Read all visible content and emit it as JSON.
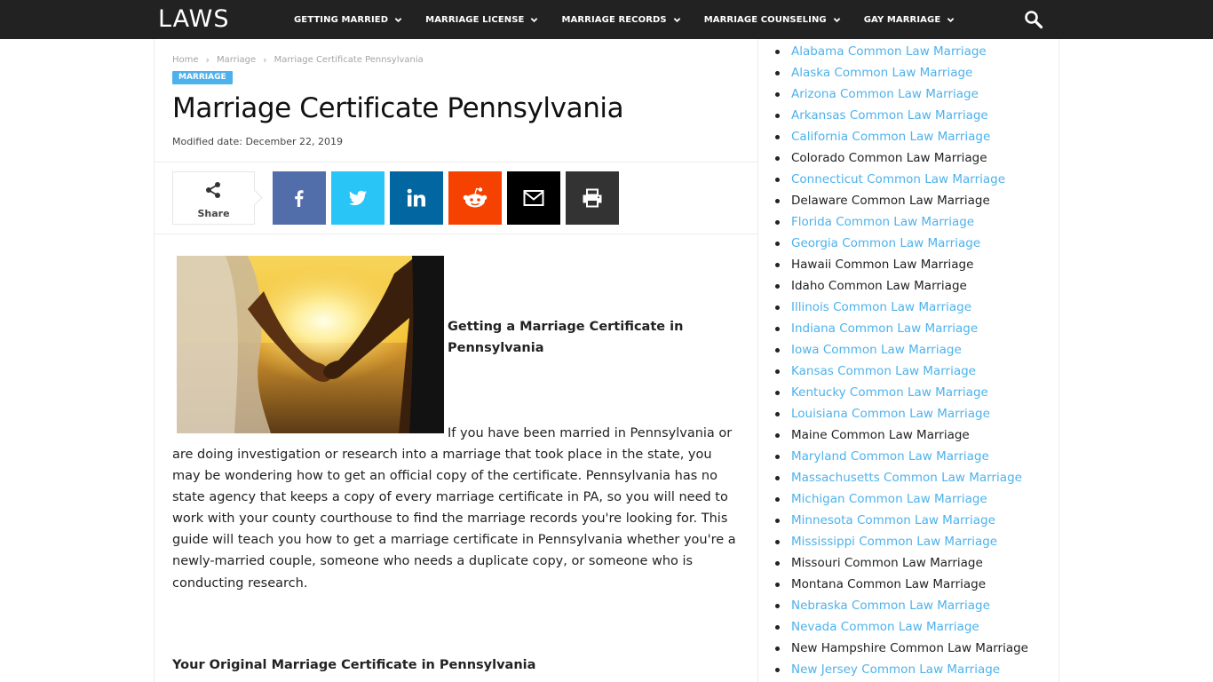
{
  "site": {
    "logo": "LAWS",
    "nav": [
      {
        "label": "GETTING MARRIED"
      },
      {
        "label": "MARRIAGE LICENSE"
      },
      {
        "label": "MARRIAGE RECORDS"
      },
      {
        "label": "MARRIAGE COUNSELING"
      },
      {
        "label": "GAY MARRIAGE"
      }
    ],
    "search_icon": "search-icon"
  },
  "breadcrumb": [
    "Home",
    "Marriage",
    "Marriage Certificate Pennsylvania"
  ],
  "article": {
    "category": "MARRIAGE",
    "title": "Marriage Certificate Pennsylvania",
    "modified": "Modified date: December 22, 2019",
    "share_label": "Share",
    "share_buttons": [
      {
        "name": "facebook",
        "color": "#516eab"
      },
      {
        "name": "twitter",
        "color": "#29c5f6"
      },
      {
        "name": "linkedin",
        "color": "#0266a0"
      },
      {
        "name": "reddit",
        "color": "#f54200"
      },
      {
        "name": "email",
        "color": "#000000"
      },
      {
        "name": "print",
        "color": "#333333"
      }
    ],
    "subheading": "Getting a Marriage Certificate in Pennsylvania",
    "intro_first_line": "If you have been married in Pennsylvania or",
    "intro_rest": "are doing investigation or research into a marriage that took place in the state, you may be wondering how to get an official copy of the certificate.  Pennsylvania has no state agency that keeps a copy of every marriage certificate in PA, so you will need to work with your county courthouse to find the marriage records you're looking for.  This guide will teach you how to get a marriage certificate in Pennsylvania whether you're a newly-married couple, someone who needs a duplicate copy, or someone who is conducting research.",
    "section_heading": "Your Original Marriage Certificate in Pennsylvania"
  },
  "sidebar": {
    "states": [
      {
        "label": "Alabama Common Law Marriage",
        "link": true
      },
      {
        "label": "Alaska Common Law Marriage",
        "link": true
      },
      {
        "label": "Arizona Common Law Marriage",
        "link": true
      },
      {
        "label": "Arkansas Common Law Marriage",
        "link": true
      },
      {
        "label": "California Common Law Marriage",
        "link": true
      },
      {
        "label": "Colorado Common Law Marriage",
        "link": false
      },
      {
        "label": "Connecticut Common Law Marriage",
        "link": true
      },
      {
        "label": "Delaware Common Law Marriage",
        "link": false
      },
      {
        "label": "Florida Common Law Marriage",
        "link": true
      },
      {
        "label": "Georgia Common Law Marriage",
        "link": true
      },
      {
        "label": "Hawaii Common Law Marriage",
        "link": false
      },
      {
        "label": "Idaho Common Law Marriage",
        "link": false
      },
      {
        "label": "Illinois Common Law Marriage",
        "link": true
      },
      {
        "label": "Indiana Common Law Marriage",
        "link": true
      },
      {
        "label": "Iowa Common Law Marriage",
        "link": true
      },
      {
        "label": "Kansas Common Law Marriage",
        "link": true
      },
      {
        "label": "Kentucky Common Law Marriage",
        "link": true
      },
      {
        "label": "Louisiana Common Law Marriage",
        "link": true
      },
      {
        "label": "Maine Common Law Marriage",
        "link": false
      },
      {
        "label": "Maryland Common Law Marriage",
        "link": true
      },
      {
        "label": "Massachusetts Common Law Marriage",
        "link": true
      },
      {
        "label": "Michigan Common Law Marriage",
        "link": true
      },
      {
        "label": "Minnesota Common Law Marriage",
        "link": true
      },
      {
        "label": "Mississippi Common Law Marriage",
        "link": true
      },
      {
        "label": "Missouri Common Law Marriage",
        "link": false
      },
      {
        "label": "Montana Common Law Marriage",
        "link": false
      },
      {
        "label": "Nebraska Common Law Marriage",
        "link": true
      },
      {
        "label": "Nevada Common Law Marriage",
        "link": true
      },
      {
        "label": "New Hampshire Common Law Marriage",
        "link": false
      },
      {
        "label": "New Jersey Common Law Marriage",
        "link": true
      }
    ]
  },
  "colors": {
    "topbar": "#222222",
    "accent": "#4db2ec",
    "link": "#4db2ec"
  }
}
